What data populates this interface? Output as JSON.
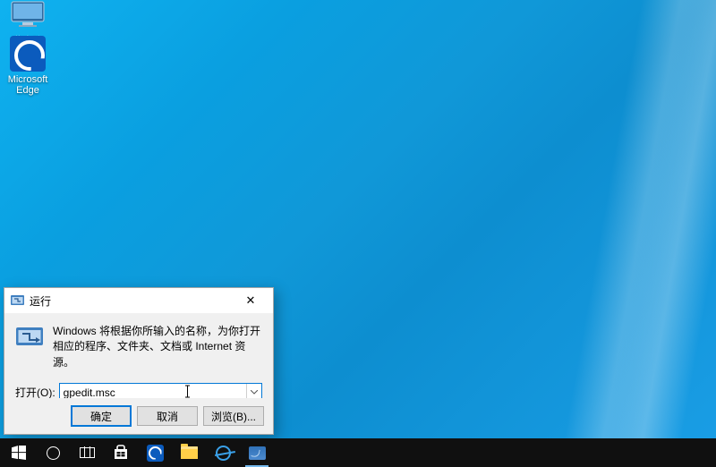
{
  "desktop": {
    "icons": [
      {
        "name": "此电脑"
      },
      {
        "name": "Microsoft Edge"
      }
    ]
  },
  "run_dialog": {
    "title": "运行",
    "description": "Windows 将根据你所输入的名称，为你打开相应的程序、文件夹、文档或 Internet 资源。",
    "open_label": "打开(O):",
    "input_value": "gpedit.msc",
    "buttons": {
      "ok": "确定",
      "cancel": "取消",
      "browse": "浏览(B)..."
    }
  },
  "taskbar": {
    "items": [
      "start",
      "search",
      "task-view",
      "store",
      "edge",
      "file-explorer",
      "internet-explorer",
      "run-task"
    ]
  },
  "colors": {
    "accent": "#0078d7"
  }
}
